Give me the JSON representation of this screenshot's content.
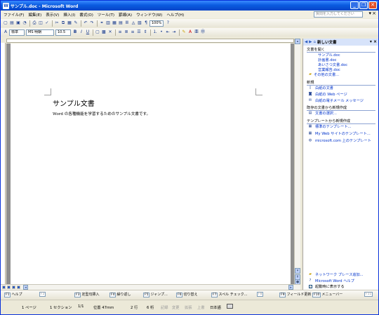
{
  "window": {
    "title": "サンプル.doc - Microsoft Word"
  },
  "menubar": {
    "items": [
      "ファイル(F)",
      "編集(E)",
      "表示(V)",
      "挿入(I)",
      "書式(O)",
      "ツール(T)",
      "罫線(A)",
      "ウィンドウ(W)",
      "ヘルプ(H)"
    ]
  },
  "helpbox": {
    "placeholder": "質問を入力してください"
  },
  "toolbar1": {
    "zoom": "100%"
  },
  "toolbar2": {
    "style": "標準",
    "font": "MS 明朝",
    "size": "10.5",
    "bold": "B",
    "italic": "I",
    "underline": "U"
  },
  "document": {
    "title": "サンプル文書",
    "body": "Word の各種機能を学習するためのサンプル文書です。"
  },
  "taskpane": {
    "header": "新しい文書",
    "sec_open": "文書を開く",
    "open_files": [
      "サンプル.doc",
      "計画書.doc",
      "あいさつ文書.doc",
      "営業報告.doc"
    ],
    "open_other": "その他の文書...",
    "sec_new": "新規",
    "new_items": [
      "白紙の文書",
      "白紙の Web ページ",
      "白紙の電子メール メッセージ"
    ],
    "sec_existing": "既存の文書から新規作成",
    "existing_item": "文書の選択...",
    "sec_template": "テンプレートから新規作成",
    "template_items": [
      "標準のテンプレート...",
      "My Web サイトのテンプレート...",
      "microsoft.com 上のテンプレート"
    ],
    "footer": [
      "ネットワーク プレース追加...",
      "Microsoft Word ヘルプ"
    ],
    "startup_checkbox": "起動時に表示する"
  },
  "fkeys": {
    "left": [
      [
        "F1",
        "ヘルプ"
      ],
      [
        "F2",
        ""
      ],
      [
        "F3",
        "定型句挿入"
      ],
      [
        "F4",
        "繰り返し"
      ],
      [
        "F5",
        "ジャンプ..."
      ],
      [
        "F6",
        "切り替え"
      ],
      [
        "F7",
        "スペル チェック..."
      ],
      [
        "F8",
        ""
      ]
    ],
    "right": [
      [
        "F9",
        "フィールド更新"
      ],
      [
        "F10",
        "メニューバー"
      ],
      [
        "F11",
        ""
      ]
    ]
  },
  "status": {
    "page": "1 ページ",
    "section": "1 セクション",
    "pages": "1/1",
    "position": "位置 47mm",
    "line": "2 行",
    "column": "6 桁",
    "rec": "記録",
    "trk": "変更",
    "ext": "拡張",
    "ovr": "上書",
    "lang": "日本語"
  }
}
